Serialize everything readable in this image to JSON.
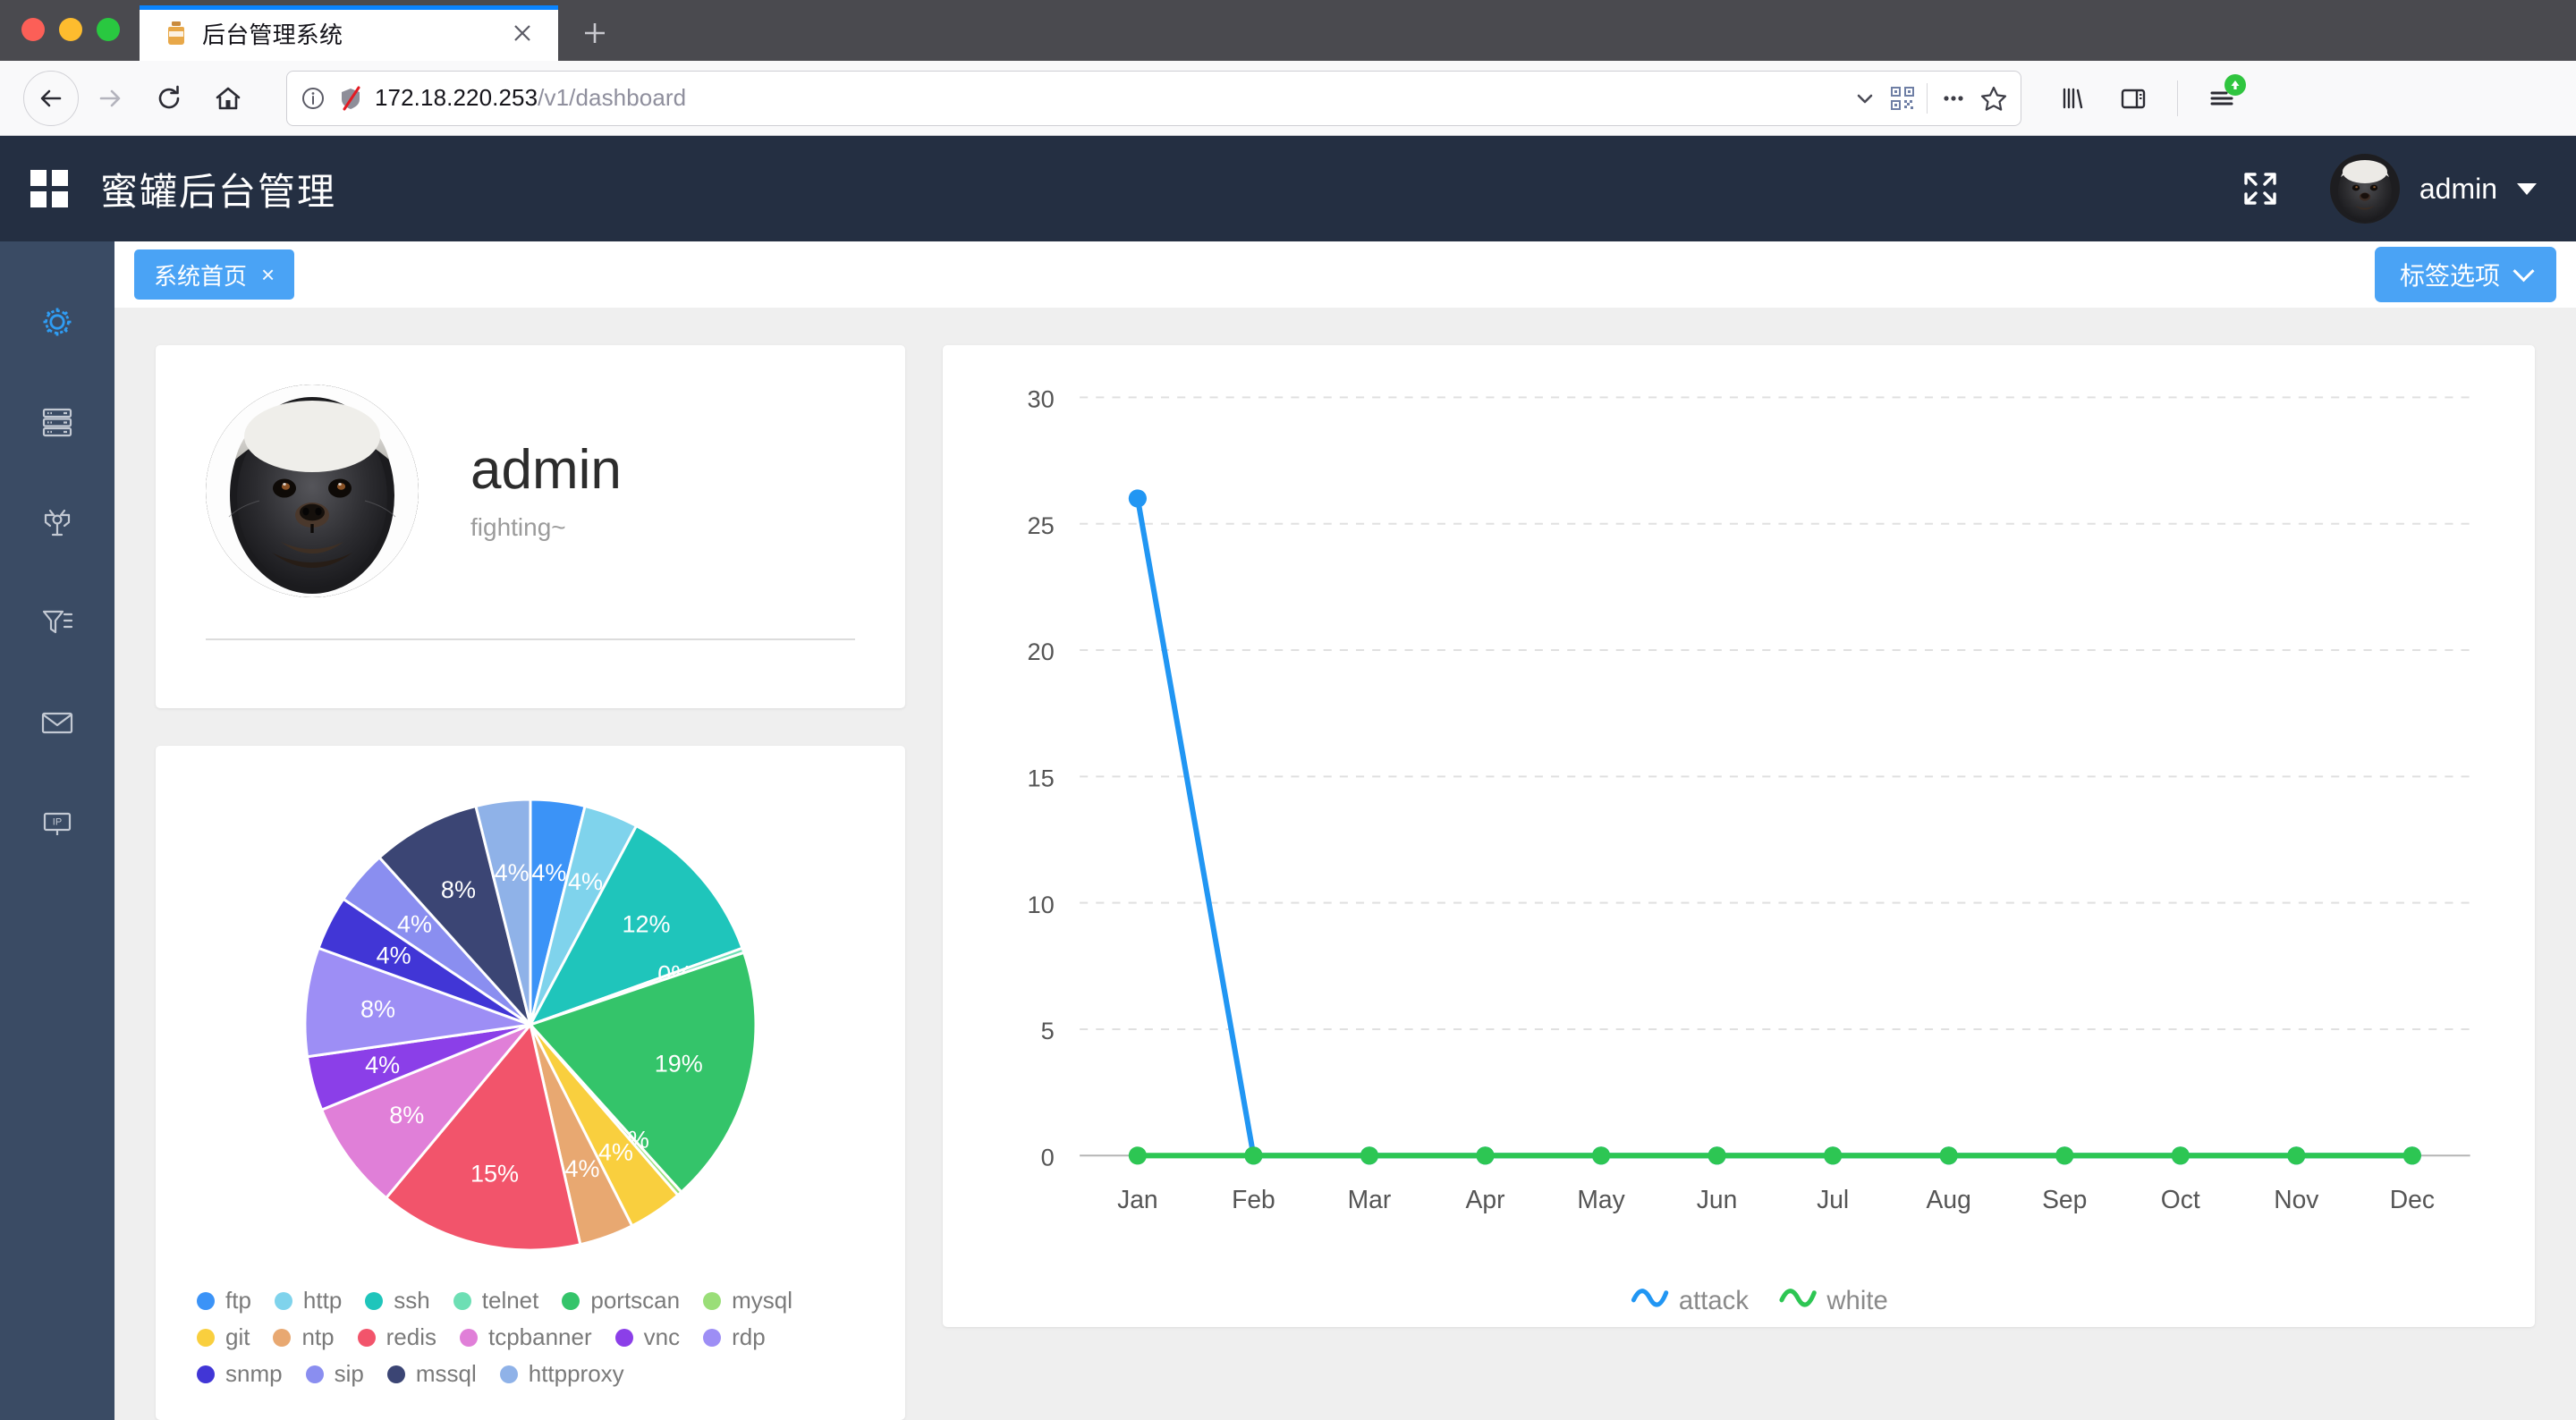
{
  "browser": {
    "tab": {
      "title": "后台管理系统",
      "favicon": "honeypot-jar-icon",
      "close": "✕"
    },
    "newtab_label": "+",
    "url": {
      "host": "172.18.220.253",
      "path": "/v1/dashboard",
      "full": "172.18.220.253/v1/dashboard"
    },
    "nav": {
      "back": "back-icon",
      "forward": "forward-icon",
      "reload": "reload-icon",
      "home": "home-icon"
    },
    "url_actions": {
      "identity": "info-icon",
      "tracking": "shield-slashed-icon",
      "dropdown": "chevron-down-icon",
      "qr": "qr-code-icon"
    },
    "toolbar": {
      "more": "ellipsis-icon",
      "bookmark": "star-icon",
      "library": "library-icon",
      "sidebar": "sidebar-icon",
      "menu": "hamburger-icon",
      "update_badge": "update-arrow-badge"
    }
  },
  "app": {
    "title": "蜜罐后台管理",
    "logo": "grid-icon",
    "fullscreen_icon": "expand-arrows-icon",
    "user": {
      "name": "admin",
      "avatar": "honey-badger-avatar",
      "caret": "caret-down-icon"
    },
    "sidebar_items": [
      {
        "name": "settings",
        "icon": "gear-icon",
        "active": true
      },
      {
        "name": "servers",
        "icon": "server-stack-icon",
        "active": false
      },
      {
        "name": "topology",
        "icon": "network-topology-icon",
        "active": false
      },
      {
        "name": "filter",
        "icon": "filter-list-icon",
        "active": false
      },
      {
        "name": "mail",
        "icon": "envelope-icon",
        "active": false
      },
      {
        "name": "ip",
        "icon": "ip-tag-icon",
        "active": false
      }
    ],
    "page_tab": {
      "label": "系统首页",
      "close": "×"
    },
    "tab_options": {
      "label": "标签选项",
      "chevron": "chevron-down-icon"
    }
  },
  "profile": {
    "name": "admin",
    "subtitle": "fighting~",
    "avatar": "honey-badger-avatar"
  },
  "chart_data": [
    {
      "type": "pie",
      "title": "",
      "legend_position": "bottom",
      "labels": [
        "ftp",
        "http",
        "ssh",
        "telnet",
        "portscan",
        "mysql",
        "git",
        "ntp",
        "redis",
        "tcpbanner",
        "vnc",
        "rdp",
        "snmp",
        "sip",
        "mssql",
        "httpproxy"
      ],
      "percent_labels": [
        "4%",
        "4%",
        "12%",
        "0%",
        "19%",
        "0%",
        "4%",
        "4%",
        "15%",
        "8%",
        "4%",
        "8%",
        "4%",
        "4%",
        "8%",
        "4%"
      ],
      "values": [
        4,
        4,
        12,
        0,
        19,
        0,
        4,
        4,
        15,
        8,
        4,
        8,
        4,
        4,
        8,
        4
      ],
      "colors": [
        "#3b93f7",
        "#7fd3ec",
        "#1fc5bb",
        "#6ddfb4",
        "#34c46a",
        "#9ade78",
        "#f9cf3e",
        "#e8a871",
        "#f2546b",
        "#e07fd8",
        "#8b3fe8",
        "#9d8ef5",
        "#4136d6",
        "#8a8ef0",
        "#3b4574",
        "#8fb2e8"
      ]
    },
    {
      "type": "line",
      "title": "",
      "xlabel": "",
      "ylabel": "",
      "categories": [
        "Jan",
        "Feb",
        "Mar",
        "Apr",
        "May",
        "Jun",
        "Jul",
        "Aug",
        "Sep",
        "Oct",
        "Nov",
        "Dec"
      ],
      "yticks": [
        "0",
        "5",
        "10",
        "15",
        "20",
        "25",
        "30"
      ],
      "ylim": [
        0,
        30
      ],
      "grid": true,
      "legend_position": "bottom",
      "series": [
        {
          "name": "attack",
          "color": "#2196f3",
          "values": [
            26,
            0,
            0,
            0,
            0,
            0,
            0,
            0,
            0,
            0,
            0,
            0
          ]
        },
        {
          "name": "white",
          "color": "#2dc653",
          "values": [
            0,
            0,
            0,
            0,
            0,
            0,
            0,
            0,
            0,
            0,
            0,
            0
          ]
        }
      ]
    }
  ]
}
